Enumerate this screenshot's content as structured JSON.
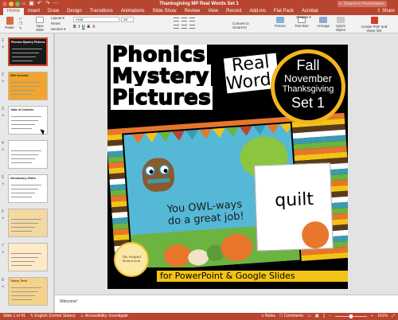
{
  "window": {
    "title": "Thanksgiving MP Real Words Set 1",
    "search_placeholder": "Search in Presentation"
  },
  "menu": {
    "tabs": [
      "Home",
      "Insert",
      "Draw",
      "Design",
      "Transitions",
      "Animations",
      "Slide Show",
      "Review",
      "View",
      "Record",
      "Add-ins",
      "Flat Pack",
      "Acrobat"
    ],
    "active_tab": "Home",
    "share_label": "Share"
  },
  "ribbon": {
    "paste": "Paste",
    "new_slide": "New Slide",
    "layout": "Layout",
    "reset": "Reset",
    "section": "Section",
    "font_name": "Arial",
    "font_size": "18",
    "bold": "B",
    "italic": "I",
    "underline": "U",
    "strike": "S",
    "picture": "Picture",
    "text_box": "Text Box",
    "arrange": "Arrange",
    "quick_styles": "Quick Styles",
    "shapes": "Shapes",
    "convert_smartart": "Convert to SmartArt",
    "create_pdf": "Create PDF and share link",
    "accent": "#b8452f"
  },
  "thumbnails": [
    {
      "num": "1",
      "title": "Phonics Mystery Pictures",
      "active": true
    },
    {
      "num": "2",
      "title": "Skill Included",
      "active": false
    },
    {
      "num": "3",
      "title": "Table of Contents",
      "active": false
    },
    {
      "num": "4",
      "title": "",
      "active": false
    },
    {
      "num": "5",
      "title": "Introductory Slides",
      "active": false
    },
    {
      "num": "6",
      "title": "",
      "active": false
    },
    {
      "num": "7",
      "title": "",
      "active": false
    },
    {
      "num": "8",
      "title": "Turkey Time!",
      "active": false
    }
  ],
  "slide": {
    "title_lines": [
      "Phonics",
      "Mystery",
      "Pictures"
    ],
    "real_words": "Real Words",
    "badge": {
      "line1": "Fall",
      "line2": "November",
      "line3": "Thanksgiving",
      "line4": "Set 1"
    },
    "owl_text": "You OWL-ways do a great job!",
    "card_word": "quilt",
    "logo_text": "The Helpful Homeroom",
    "footer": "for PowerPoint & Google Slides"
  },
  "notes": {
    "text": "Welcome!"
  },
  "status": {
    "slide_of": "Slide 1 of 41",
    "language": "English (United States)",
    "accessibility": "Accessibility: Investigate",
    "notes_btn": "Notes",
    "comments_btn": "Comments",
    "zoom": "161%"
  }
}
